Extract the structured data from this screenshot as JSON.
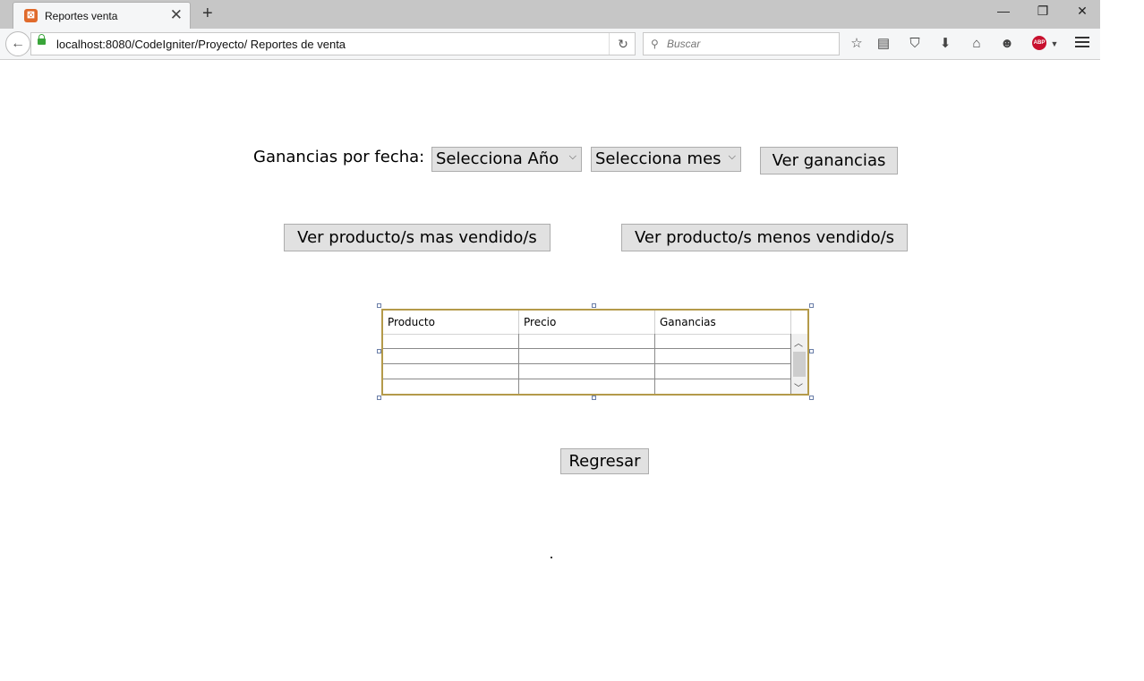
{
  "browser": {
    "tab_title": "Reportes venta",
    "new_tab_symbol": "+",
    "close_symbol": "✕",
    "url": "localhost:8080/CodeIgniter/Proyecto/ Reportes de venta",
    "search_placeholder": "Buscar",
    "window_controls": {
      "minimize": "—",
      "restore": "❐",
      "close": "✕"
    },
    "toolbar_icons": [
      "star-icon",
      "reading-list-icon",
      "pocket-icon",
      "download-icon",
      "home-icon",
      "chat-icon",
      "adblock-plus-icon",
      "menu-icon"
    ],
    "abp_label": "ABP"
  },
  "page": {
    "ganancias_label": "Ganancias por fecha:",
    "year_select": {
      "selected": "Selecciona Año"
    },
    "month_select": {
      "selected": "Selecciona mes"
    },
    "ver_ganancias_button": "Ver ganancias",
    "mas_vendidos_button": "Ver producto/s mas vendido/s",
    "menos_vendidos_button": "Ver producto/s menos vendido/s",
    "table": {
      "columns": [
        "Producto",
        "Precio",
        "Ganancias"
      ],
      "rows": [
        [
          "",
          "",
          ""
        ],
        [
          "",
          "",
          ""
        ],
        [
          "",
          "",
          ""
        ],
        [
          "",
          "",
          ""
        ]
      ]
    },
    "regresar_button": "Regresar"
  },
  "colors": {
    "button_bg": "#e1e1e1",
    "button_border": "#adadad",
    "grid_border": "#b49a4a",
    "tabbar_bg": "#c6c6c6",
    "navbar_bg": "#f5f6f7"
  }
}
